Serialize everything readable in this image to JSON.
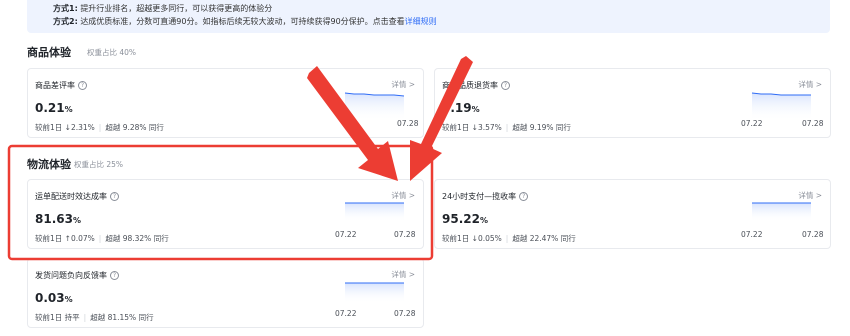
{
  "info": {
    "line1_label": "方式1:",
    "line1_text": "提升行业排名，超越更多同行，可以获得更高的体验分",
    "line2_label": "方式2:",
    "line2_text": "达成优质标准，分数可直通90分。如指标后续无较大波动，可持续获得90分保护。点击查看",
    "line2_link": "详细规则"
  },
  "sections": [
    {
      "title": "商品体验",
      "weight": "权重占比 40%",
      "cards": [
        {
          "name": "商品差评率",
          "detail": "详情 >",
          "value": "0.21",
          "unit": "%",
          "compare_label": "较前1日",
          "compare_dir": "↓",
          "compare_value": "2.31%",
          "beat": "超越 9.28% 同行",
          "date_start": "",
          "date_end": "07.28"
        },
        {
          "name": "商品品质退货率",
          "detail": "详情 >",
          "value": "0.19",
          "unit": "%",
          "compare_label": "较前1日",
          "compare_dir": "↓",
          "compare_value": "3.57%",
          "beat": "超越 9.19% 同行",
          "date_start": "07.22",
          "date_end": "07.28"
        }
      ]
    },
    {
      "title": "物流体验",
      "weight": "权重占比 25%",
      "cards": [
        {
          "name": "运单配送时效达成率",
          "detail": "详情 >",
          "value": "81.63",
          "unit": "%",
          "compare_label": "较前1日",
          "compare_dir": "↑",
          "compare_value": "0.07%",
          "beat": "超越 98.32% 同行",
          "date_start": "07.22",
          "date_end": "07.28"
        },
        {
          "name": "24小时支付—揽收率",
          "detail": "详情 >",
          "value": "95.22",
          "unit": "%",
          "compare_label": "较前1日",
          "compare_dir": "↓",
          "compare_value": "0.05%",
          "beat": "超越 22.47% 同行",
          "date_start": "07.22",
          "date_end": "07.28"
        },
        {
          "name": "发货问题负向反馈率",
          "detail": "详情 >",
          "value": "0.03",
          "unit": "%",
          "compare_label": "较前1日",
          "compare_dir": "",
          "compare_value": "持平",
          "beat": "超越 81.15% 同行",
          "date_start": "07.22",
          "date_end": "07.28"
        }
      ]
    }
  ],
  "colors": {
    "accent": "#2f6cf6",
    "annotation_red": "#ec3d33",
    "info_bg": "#eef3fe"
  }
}
